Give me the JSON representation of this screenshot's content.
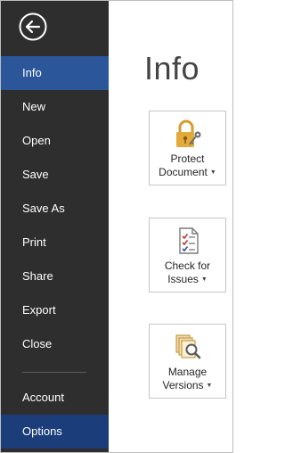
{
  "sidebar": {
    "back_icon": "back-arrow-icon",
    "items": [
      {
        "label": "Info",
        "name": "sidebar-item-info",
        "selected": true
      },
      {
        "label": "New",
        "name": "sidebar-item-new"
      },
      {
        "label": "Open",
        "name": "sidebar-item-open"
      },
      {
        "label": "Save",
        "name": "sidebar-item-save"
      },
      {
        "label": "Save As",
        "name": "sidebar-item-save-as"
      },
      {
        "label": "Print",
        "name": "sidebar-item-print"
      },
      {
        "label": "Share",
        "name": "sidebar-item-share"
      },
      {
        "label": "Export",
        "name": "sidebar-item-export"
      },
      {
        "label": "Close",
        "name": "sidebar-item-close"
      }
    ],
    "bottom_items": [
      {
        "label": "Account",
        "name": "sidebar-item-account"
      },
      {
        "label": "Options",
        "name": "sidebar-item-options"
      }
    ]
  },
  "main": {
    "title": "Info",
    "tiles": [
      {
        "line1": "Protect",
        "line2": "Document",
        "icon": "lock-key-icon",
        "has_dropdown": true
      },
      {
        "line1": "Check for",
        "line2": "Issues",
        "icon": "checklist-document-icon",
        "has_dropdown": true
      },
      {
        "line1": "Manage",
        "line2": "Versions",
        "icon": "versions-search-icon",
        "has_dropdown": true
      }
    ]
  },
  "colors": {
    "sidebar_bg": "#2e2e2e",
    "selected_bg": "#2b579a",
    "options_bg": "#1b3e7a",
    "lock_gold": "#e2a93b",
    "check_red": "#c0392b",
    "check_blue": "#2b579a"
  }
}
